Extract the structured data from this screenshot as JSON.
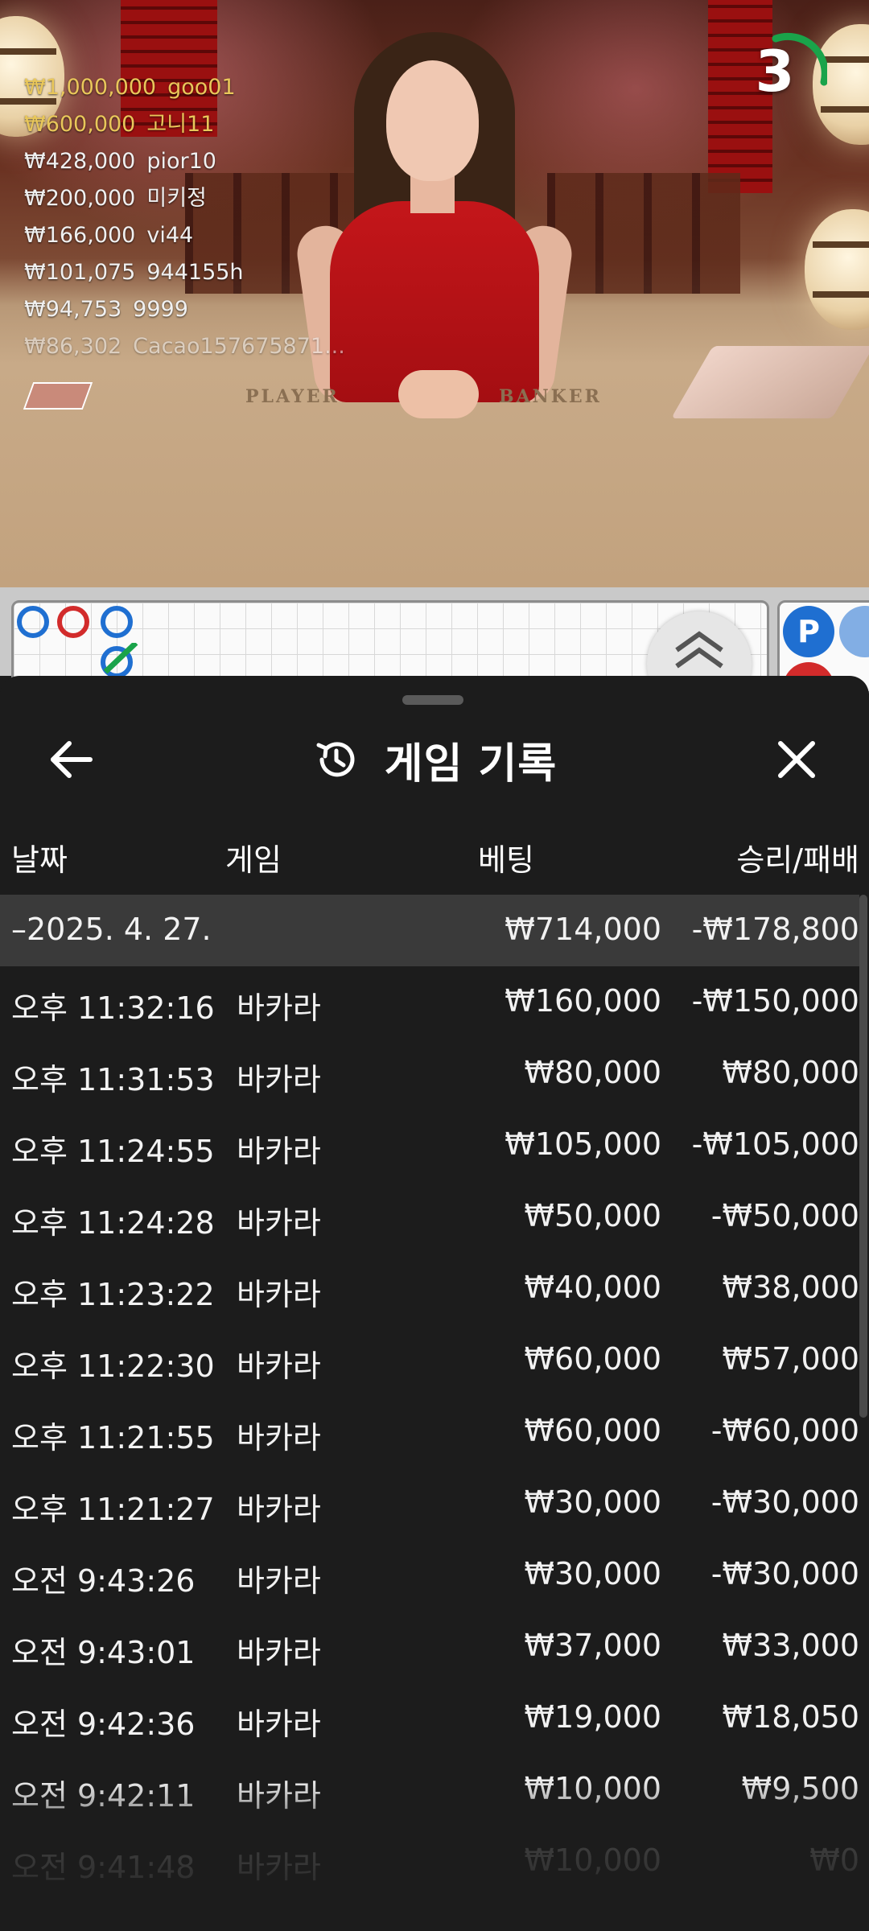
{
  "video": {
    "table_labels": {
      "player": "PLAYER",
      "banker": "BANKER"
    }
  },
  "leaderboard": [
    {
      "amount": "₩1,000,000",
      "name": "goo01",
      "top": true
    },
    {
      "amount": "₩600,000",
      "name": "고니11",
      "top": true
    },
    {
      "amount": "₩428,000",
      "name": "pior10",
      "top": false
    },
    {
      "amount": "₩200,000",
      "name": "미키정",
      "top": false
    },
    {
      "amount": "₩166,000",
      "name": "vi44",
      "top": false
    },
    {
      "amount": "₩101,075",
      "name": "944155h",
      "top": false
    },
    {
      "amount": "₩94,753",
      "name": "9999",
      "top": false
    },
    {
      "amount": "₩86,302",
      "name": "Cacao157675871...",
      "top": false
    }
  ],
  "timer": {
    "value": "3",
    "color": "#1aa34a"
  },
  "roadmap": {
    "predict_player": "P",
    "colors": {
      "player": "#1f6fd1",
      "banker": "#d22b2b",
      "tie": "#1aa34a"
    }
  },
  "sheet": {
    "title": "게임 기록",
    "icons": {
      "back": "arrow-left-icon",
      "close": "close-icon",
      "history": "history-icon"
    },
    "columns": {
      "date": "날짜",
      "game": "게임",
      "bet": "베팅",
      "result": "승리/패배"
    },
    "date_row": {
      "date": "–2025. 4. 27.",
      "bet": "₩714,000",
      "result": "-₩178,800"
    },
    "rows": [
      {
        "time": "오후 11:32:16",
        "game": "바카라",
        "bet": "₩160,000",
        "result": "-₩150,000"
      },
      {
        "time": "오후 11:31:53",
        "game": "바카라",
        "bet": "₩80,000",
        "result": "₩80,000"
      },
      {
        "time": "오후 11:24:55",
        "game": "바카라",
        "bet": "₩105,000",
        "result": "-₩105,000"
      },
      {
        "time": "오후 11:24:28",
        "game": "바카라",
        "bet": "₩50,000",
        "result": "-₩50,000"
      },
      {
        "time": "오후 11:23:22",
        "game": "바카라",
        "bet": "₩40,000",
        "result": "₩38,000"
      },
      {
        "time": "오후 11:22:30",
        "game": "바카라",
        "bet": "₩60,000",
        "result": "₩57,000"
      },
      {
        "time": "오후 11:21:55",
        "game": "바카라",
        "bet": "₩60,000",
        "result": "-₩60,000"
      },
      {
        "time": "오후 11:21:27",
        "game": "바카라",
        "bet": "₩30,000",
        "result": "-₩30,000"
      },
      {
        "time": "오전 9:43:26",
        "game": "바카라",
        "bet": "₩30,000",
        "result": "-₩30,000"
      },
      {
        "time": "오전 9:43:01",
        "game": "바카라",
        "bet": "₩37,000",
        "result": "₩33,000"
      },
      {
        "time": "오전 9:42:36",
        "game": "바카라",
        "bet": "₩19,000",
        "result": "₩18,050"
      },
      {
        "time": "오전 9:42:11",
        "game": "바카라",
        "bet": "₩10,000",
        "result": "₩9,500"
      },
      {
        "time": "오전 9:41:48",
        "game": "바카라",
        "bet": "₩10,000",
        "result": "₩0"
      }
    ]
  }
}
